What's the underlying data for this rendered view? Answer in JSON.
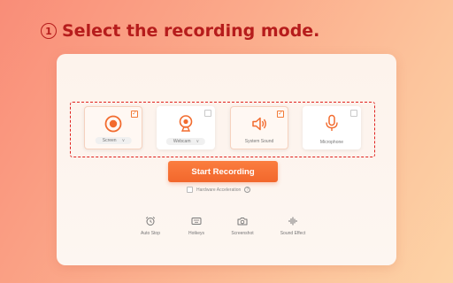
{
  "headline": {
    "step": "1",
    "text": "Select the recording mode."
  },
  "modes": [
    {
      "icon": "record-icon",
      "label": "Screen",
      "has_dropdown": true,
      "checked": true
    },
    {
      "icon": "webcam-icon",
      "label": "Webcam",
      "has_dropdown": true,
      "checked": false
    },
    {
      "icon": "speaker-icon",
      "label": "System Sound",
      "has_dropdown": false,
      "checked": true
    },
    {
      "icon": "microphone-icon",
      "label": "Microphone",
      "has_dropdown": false,
      "checked": false
    }
  ],
  "start_button": "Start Recording",
  "hardware_acceleration": {
    "label": "Hardware Acceleration",
    "checked": false
  },
  "tools": [
    {
      "icon": "alarm-clock-icon",
      "label": "Auto Stop"
    },
    {
      "icon": "keyboard-icon",
      "label": "Hotkeys"
    },
    {
      "icon": "camera-icon",
      "label": "Screenshot"
    },
    {
      "icon": "soundwave-icon",
      "label": "Sound Effect"
    }
  ],
  "colors": {
    "accent": "#f26b2e",
    "headline": "#b61c1c",
    "dashed_border": "#e0221f"
  }
}
